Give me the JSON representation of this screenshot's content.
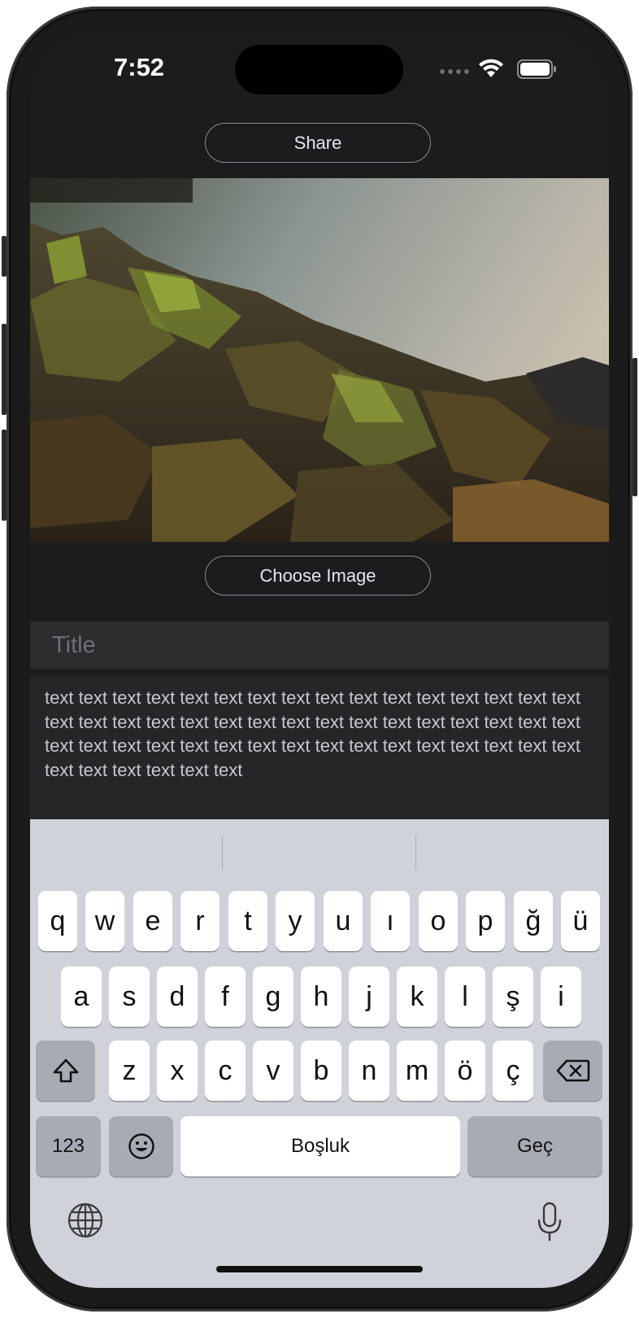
{
  "status_bar": {
    "time": "7:52"
  },
  "toolbar": {
    "share_label": "Share"
  },
  "image_section": {
    "choose_image_label": "Choose Image"
  },
  "form": {
    "title_placeholder": "Title",
    "body_text": "text text text text text text text text text text text text text text text text text text text text text text text text text text text text text text text text text text text text text text text text text text text text text text text text text text text text text text"
  },
  "keyboard": {
    "row1": [
      "q",
      "w",
      "e",
      "r",
      "t",
      "y",
      "u",
      "ı",
      "o",
      "p",
      "ğ",
      "ü"
    ],
    "row2": [
      "a",
      "s",
      "d",
      "f",
      "g",
      "h",
      "j",
      "k",
      "l",
      "ş",
      "i"
    ],
    "row3": [
      "z",
      "x",
      "c",
      "v",
      "b",
      "n",
      "m",
      "ö",
      "ç"
    ],
    "numbers_label": "123",
    "space_label": "Boşluk",
    "return_label": "Geç",
    "icons": [
      "shift-icon",
      "backspace-icon",
      "emoji-icon",
      "globe-icon",
      "microphone-icon"
    ]
  }
}
